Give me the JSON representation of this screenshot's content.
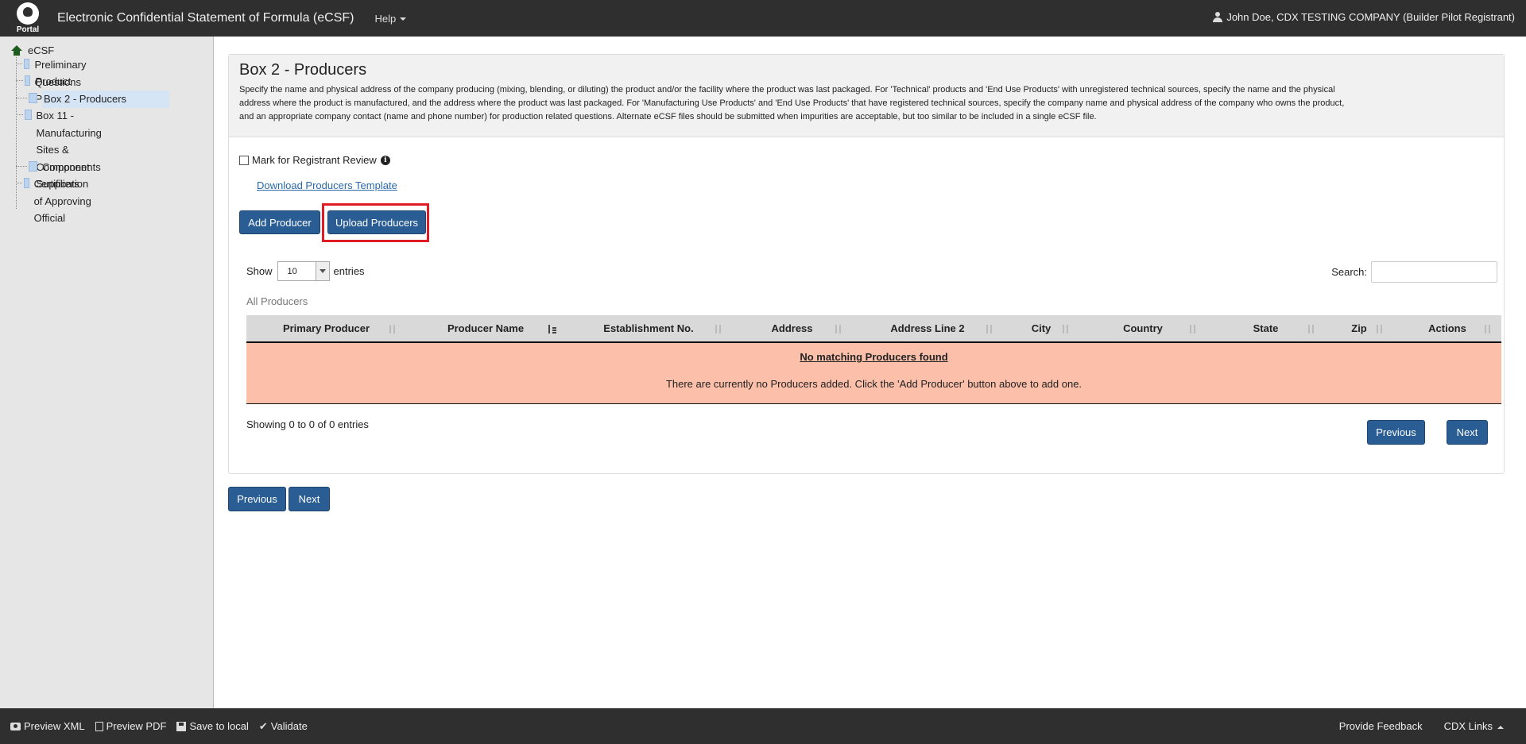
{
  "header": {
    "logo_text": "Portal",
    "app_title": "Electronic Confidential Statement of Formula (eCSF)",
    "help_label": "Help",
    "user_label": "John Doe, CDX TESTING COMPANY (Builder Pilot Registrant)"
  },
  "sidebar": {
    "root_label": "eCSF",
    "items": [
      {
        "label": "Preliminary Questions"
      },
      {
        "label": "Product Properties"
      },
      {
        "label": "Box 2 - Producers"
      },
      {
        "label_line1": "Box 11 - Manufacturing",
        "label_line2": "Sites & Component",
        "label_line3": "Suppliers"
      },
      {
        "label": "Components"
      },
      {
        "label_line1": "Certification of Approving",
        "label_line2": "Official"
      }
    ]
  },
  "main": {
    "title": "Box 2 - Producers",
    "description_line1": "Specify the name and physical address of the company producing (mixing, blending, or diluting) the product and/or the facility where the product was last packaged. For 'Technical' products and 'End Use Products' with unregistered technical sources, specify the name and the physical",
    "description_line2": "address where the product is manufactured, and the address where the product was last packaged. For 'Manufacturing Use Products' and 'End Use Products' that have registered technical sources, specify the company name and physical address of the company who owns the product,",
    "description_line3": "and an appropriate company contact (name and phone number) for production related questions. Alternate eCSF files should be submitted when impurities are acceptable, but too similar to be included in a single eCSF file.",
    "review_label": "Mark for Registrant Review",
    "info_glyph": "i",
    "template_link": "Download Producers Template",
    "add_button": "Add Producer",
    "upload_button": "Upload Producers",
    "show_label": "Show",
    "entries_value": "10",
    "entries_label": "entries",
    "search_label": "Search:",
    "all_label": "All Producers",
    "columns": [
      "Primary Producer",
      "Producer Name",
      "Establishment No.",
      "Address",
      "Address Line 2",
      "City",
      "Country",
      "State",
      "Zip",
      "Actions"
    ],
    "no_match": "No matching Producers found",
    "no_match_desc": "There are currently no Producers added. Click the 'Add Producer' button above to add one.",
    "showing_text": "Showing 0 to 0 of 0 entries",
    "table_prev": "Previous",
    "table_next": "Next",
    "page_prev": "Previous",
    "page_next": "Next"
  },
  "footer": {
    "preview_xml": "Preview XML",
    "preview_pdf": "Preview PDF",
    "save_local": "Save to local",
    "validate": "Validate",
    "check_glyph": "✔",
    "feedback": "Provide Feedback",
    "cdx_links": "CDX Links"
  },
  "colors": {
    "accent": "#2a5d93",
    "highlight": "#e01b24",
    "empty_row": "#fbbfaa"
  }
}
